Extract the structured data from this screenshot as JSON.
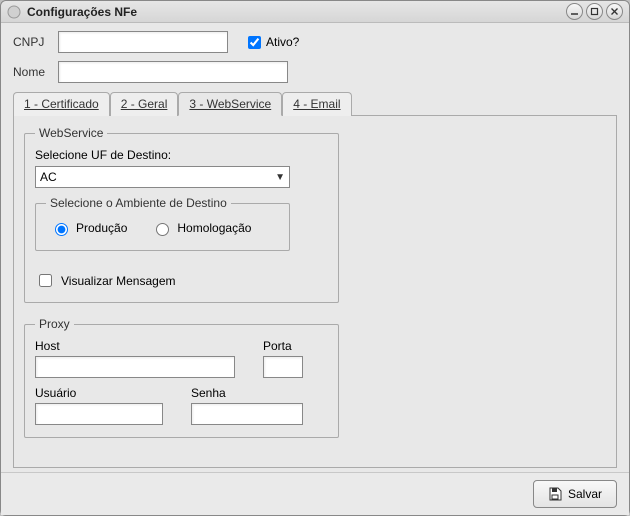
{
  "window": {
    "title": "Configurações NFe"
  },
  "form": {
    "cnpj_label": "CNPJ",
    "cnpj_value": "",
    "nome_label": "Nome",
    "nome_value": "",
    "ativo_label": "Ativo?",
    "ativo_checked": true
  },
  "tabs": [
    {
      "label": "1 - Certificado"
    },
    {
      "label": "2 - Geral"
    },
    {
      "label": "3 - WebService"
    },
    {
      "label": "4 - Email"
    }
  ],
  "activeTab": 2,
  "webservice": {
    "legend": "WebService",
    "uf_label": "Selecione UF de Destino:",
    "uf_value": "AC",
    "ambiente_legend": "Selecione o Ambiente de Destino",
    "radio_producao": "Produção",
    "radio_homolog": "Homologação",
    "radio_selected": "producao",
    "visualizar_label": "Visualizar Mensagem",
    "visualizar_checked": false
  },
  "proxy": {
    "legend": "Proxy",
    "host_label": "Host",
    "host_value": "",
    "porta_label": "Porta",
    "porta_value": "",
    "usuario_label": "Usuário",
    "usuario_value": "",
    "senha_label": "Senha",
    "senha_value": ""
  },
  "footer": {
    "salvar_label": "Salvar"
  }
}
